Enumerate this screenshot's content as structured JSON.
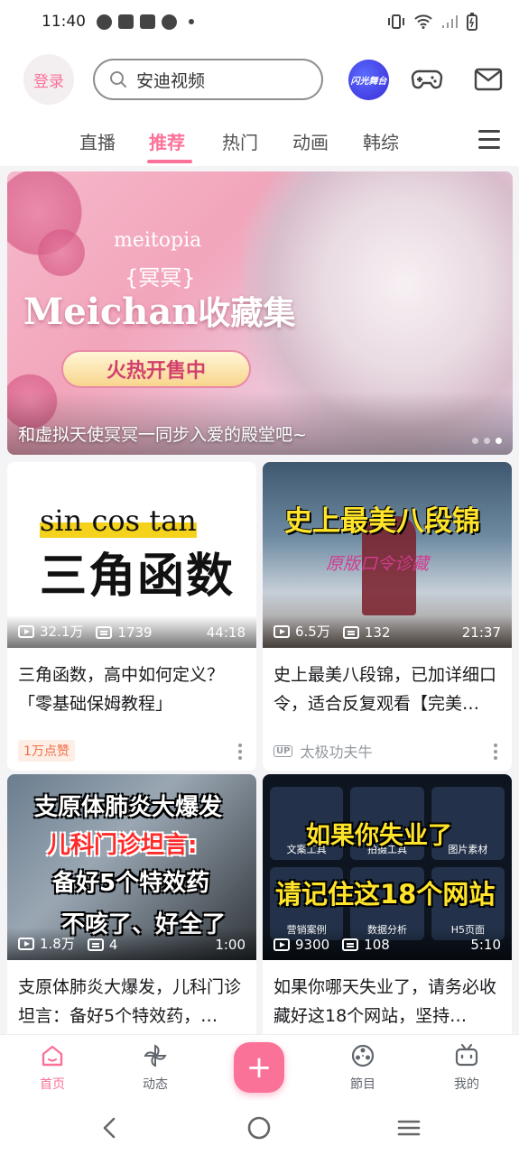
{
  "status_bar": {
    "time": "11:40"
  },
  "header": {
    "login_label": "登录",
    "search_text": "安迪视频",
    "flash_label": "闪光舞台"
  },
  "tabs": [
    {
      "label": "直播",
      "active": false
    },
    {
      "label": "推荐",
      "active": true
    },
    {
      "label": "热门",
      "active": false
    },
    {
      "label": "动画",
      "active": false
    },
    {
      "label": "韩综",
      "active": false
    }
  ],
  "banner": {
    "brand": "meitopia",
    "subtitle": "{冥冥}",
    "title_latin": "Meichan",
    "title_cn": "收藏集",
    "sale_label": "火热开售中",
    "caption": "和虚拟天使冥冥一同步入爱的殿堂吧~"
  },
  "cards": [
    {
      "thumb_lines": [
        "sin  cos  tan",
        "三角函数"
      ],
      "views": "32.1万",
      "danmaku": "1739",
      "duration": "44:18",
      "title": "三角函数，高中如何定义？「零基础保姆教程」",
      "tag": "1万点赞"
    },
    {
      "thumb_lines": [
        "史上最美八段锦",
        "原版口令诊藏"
      ],
      "views": "6.5万",
      "danmaku": "132",
      "duration": "21:37",
      "title": "史上最美八段锦，已加详细口令，适合反复观看【完美…",
      "up_label": "UP",
      "author": "太极功夫牛"
    },
    {
      "thumb_lines": [
        "支原体肺炎大爆发",
        "儿科门诊坦言:",
        "备好5个特效药",
        "不咳了、好全了"
      ],
      "views": "1.8万",
      "danmaku": "4",
      "duration": "1:00",
      "title": "支原体肺炎大爆发，儿科门诊坦言：备好5个特效药，…"
    },
    {
      "thumb_lines": [
        "如果你失业了",
        "请记住这18个网站"
      ],
      "thumb_apps": [
        "文案工具",
        "拍摄工具",
        "图片素材",
        "营销案例",
        "数据分析",
        "H5页面"
      ],
      "views": "9300",
      "danmaku": "108",
      "duration": "5:10",
      "title": "如果你哪天失业了，请务必收藏好这18个网站，坚持…"
    }
  ],
  "bottom_nav": [
    {
      "label": "首页",
      "icon": "home-icon",
      "active": true
    },
    {
      "label": "动态",
      "icon": "pinwheel-icon",
      "active": false
    },
    {
      "label": "+",
      "icon": "plus-icon",
      "active": false
    },
    {
      "label": "節目",
      "icon": "film-reel-icon",
      "active": false
    },
    {
      "label": "我的",
      "icon": "tv-icon",
      "active": false
    }
  ],
  "colors": {
    "accent": "#fb7299",
    "tag_bg": "#fdeee6",
    "tag_text": "#f26d48"
  }
}
